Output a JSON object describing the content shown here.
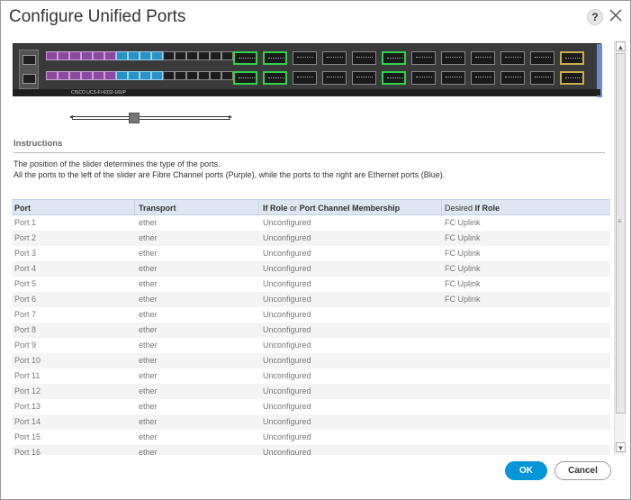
{
  "dialog": {
    "title": "Configure Unified Ports",
    "help": "?"
  },
  "switch_image": {
    "model_label": "CISCO UCS-FI-6332-16UP"
  },
  "instructions": {
    "heading": "Instructions",
    "line1": "The position of the slider determines the type of the ports.",
    "line2": "All the ports to the left of the slider are Fibre Channel ports (Purple), while the ports to the right are Ethernet ports (Blue)."
  },
  "table": {
    "headers": {
      "port": "Port",
      "transport": "Transport",
      "ifrole_a": "If Role",
      "ifrole_or": "or",
      "ifrole_b": "Port Channel Membership",
      "desired_a": "Desired",
      "desired_b": "If Role"
    },
    "rows": [
      {
        "port": "Port 1",
        "transport": "ether",
        "role": "Unconfigured",
        "desired": "FC Uplink"
      },
      {
        "port": "Port 2",
        "transport": "ether",
        "role": "Unconfigured",
        "desired": "FC Uplink"
      },
      {
        "port": "Port 3",
        "transport": "ether",
        "role": "Unconfigured",
        "desired": "FC Uplink"
      },
      {
        "port": "Port 4",
        "transport": "ether",
        "role": "Unconfigured",
        "desired": "FC Uplink"
      },
      {
        "port": "Port 5",
        "transport": "ether",
        "role": "Unconfigured",
        "desired": "FC Uplink"
      },
      {
        "port": "Port 6",
        "transport": "ether",
        "role": "Unconfigured",
        "desired": "FC Uplink"
      },
      {
        "port": "Port 7",
        "transport": "ether",
        "role": "Unconfigured",
        "desired": ""
      },
      {
        "port": "Port 8",
        "transport": "ether",
        "role": "Unconfigured",
        "desired": ""
      },
      {
        "port": "Port 9",
        "transport": "ether",
        "role": "Unconfigured",
        "desired": ""
      },
      {
        "port": "Port 10",
        "transport": "ether",
        "role": "Unconfigured",
        "desired": ""
      },
      {
        "port": "Port 11",
        "transport": "ether",
        "role": "Unconfigured",
        "desired": ""
      },
      {
        "port": "Port 12",
        "transport": "ether",
        "role": "Unconfigured",
        "desired": ""
      },
      {
        "port": "Port 13",
        "transport": "ether",
        "role": "Unconfigured",
        "desired": ""
      },
      {
        "port": "Port 14",
        "transport": "ether",
        "role": "Unconfigured",
        "desired": ""
      },
      {
        "port": "Port 15",
        "transport": "ether",
        "role": "Unconfigured",
        "desired": ""
      },
      {
        "port": "Port 16",
        "transport": "ether",
        "role": "Unconfigured",
        "desired": ""
      }
    ]
  },
  "buttons": {
    "ok": "OK",
    "cancel": "Cancel"
  },
  "colors": {
    "fc_port": "#8b4aa0",
    "eth_port": "#2a93c6",
    "ok_button": "#0696d7",
    "header_bg": "#dde6f1"
  }
}
